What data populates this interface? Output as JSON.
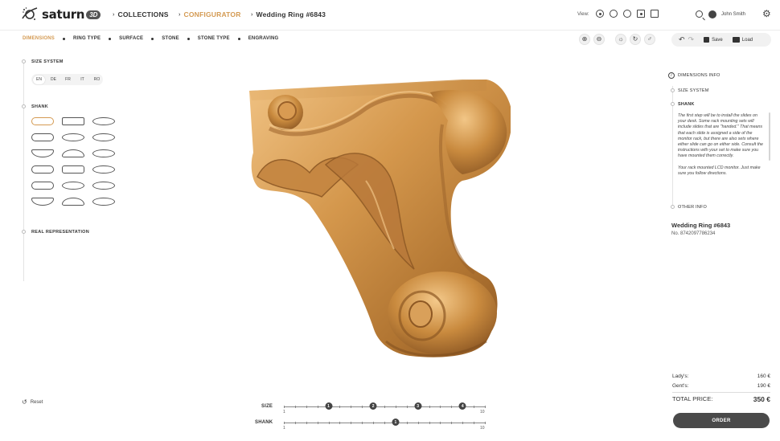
{
  "brand": {
    "name": "saturn",
    "badge": "3D"
  },
  "nav": {
    "breadcrumbs": [
      {
        "label": "COLLECTIONS",
        "active": false
      },
      {
        "label": "CONFIGURATOR",
        "active": true
      },
      {
        "label": "Wedding Ring #6843",
        "active": false
      }
    ],
    "view_label": "View:",
    "view_icons": [
      "view-3d-icon",
      "view-clock-icon",
      "view-pie-icon",
      "view-focus-icon",
      "view-grid-icon"
    ],
    "user_name": "John Smith",
    "icons": [
      "search-icon",
      "user-icon",
      "gear-icon"
    ]
  },
  "steps": [
    {
      "label": "DIMENSIONS",
      "active": true
    },
    {
      "label": "RING TYPE",
      "active": false
    },
    {
      "label": "SURFACE",
      "active": false
    },
    {
      "label": "STONE",
      "active": false
    },
    {
      "label": "STONE TYPE",
      "active": false
    },
    {
      "label": "ENGRAVING",
      "active": false
    }
  ],
  "toolbar": {
    "zoom_icons": [
      "zoom-in-icon",
      "zoom-out-icon"
    ],
    "view_tools": [
      "light-icon",
      "rotate-icon",
      "gender-icon"
    ],
    "save_label": "Save",
    "load_label": "Load"
  },
  "left": {
    "size_system_title": "SIZE SYSTEM",
    "size_systems": [
      {
        "label": "EN",
        "active": true
      },
      {
        "label": "DE",
        "active": false
      },
      {
        "label": "FR",
        "active": false
      },
      {
        "label": "IT",
        "active": false
      },
      {
        "label": "RO",
        "active": false
      }
    ],
    "shank_title": "SHANK",
    "shank_shape_count": 18,
    "selected_shank": 0,
    "real_rep_title": "REAL REPRESENTATION",
    "reset_label": "Reset"
  },
  "sliders": {
    "size": {
      "label": "SIZE",
      "min": "1",
      "max": "10",
      "thumbs": [
        "1",
        "2",
        "3",
        "4"
      ],
      "thumb_values": [
        3,
        5,
        7,
        9
      ]
    },
    "shank": {
      "label": "SHANK",
      "min": "1",
      "max": "10",
      "thumbs": [
        "1"
      ],
      "thumb_values": [
        6
      ]
    }
  },
  "right": {
    "info_title": "DIMENSIONS INFO",
    "size_system": "SIZE SYSTEM",
    "shank": "SHANK",
    "shank_desc_1": "The first step will be to install the slides on your desk. Some rack mounting sets will include slides that are \"handed.\" That means that each slide is assigned a side of the monitor rack, but there are also sets where either slide can go on either side. Consult the instructions with your set to make sure you have mounted them correctly.",
    "shank_desc_2": "Your rack mounted LCD monitor. Just make sure you follow directions.",
    "other_info": "OTHER INFO",
    "product_name": "Wedding Ring #6843",
    "product_no": "No. 8742097786234"
  },
  "prices": {
    "lady_label": "Lady's:",
    "lady_value": "160 €",
    "gent_label": "Gent's:",
    "gent_value": "190 €",
    "total_label": "TOTAL PRICE:",
    "total_value": "350 €"
  },
  "order_label": "ORDER",
  "colors": {
    "accent": "#d49a52",
    "dark": "#4a4a4a",
    "gold": "#c8873c"
  }
}
